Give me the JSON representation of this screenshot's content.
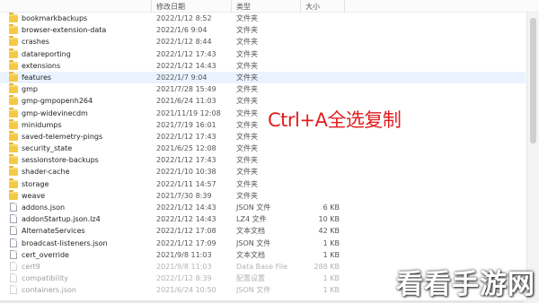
{
  "columns": {
    "name": "",
    "date": "修改日期",
    "type": "类型",
    "size": "大小"
  },
  "files": [
    {
      "name": "bookmarkbackups",
      "date": "2022/1/12 8:52",
      "type": "文件夹",
      "size": "",
      "kind": "folder"
    },
    {
      "name": "browser-extension-data",
      "date": "2022/1/6 9:04",
      "type": "文件夹",
      "size": "",
      "kind": "folder"
    },
    {
      "name": "crashes",
      "date": "2022/1/12 8:44",
      "type": "文件夹",
      "size": "",
      "kind": "folder"
    },
    {
      "name": "datareporting",
      "date": "2022/1/12 17:43",
      "type": "文件夹",
      "size": "",
      "kind": "folder"
    },
    {
      "name": "extensions",
      "date": "2022/1/12 14:43",
      "type": "文件夹",
      "size": "",
      "kind": "folder"
    },
    {
      "name": "features",
      "date": "2022/1/7 9:04",
      "type": "文件夹",
      "size": "",
      "kind": "folder",
      "selected": true
    },
    {
      "name": "gmp",
      "date": "2021/7/28 15:49",
      "type": "文件夹",
      "size": "",
      "kind": "folder"
    },
    {
      "name": "gmp-gmpopenh264",
      "date": "2021/6/24 11:03",
      "type": "文件夹",
      "size": "",
      "kind": "folder"
    },
    {
      "name": "gmp-widevinecdm",
      "date": "2021/11/19 12:08",
      "type": "文件夹",
      "size": "",
      "kind": "folder"
    },
    {
      "name": "minidumps",
      "date": "2021/7/19 16:01",
      "type": "文件夹",
      "size": "",
      "kind": "folder"
    },
    {
      "name": "saved-telemetry-pings",
      "date": "2022/1/12 17:43",
      "type": "文件夹",
      "size": "",
      "kind": "folder"
    },
    {
      "name": "security_state",
      "date": "2021/6/25 12:08",
      "type": "文件夹",
      "size": "",
      "kind": "folder"
    },
    {
      "name": "sessionstore-backups",
      "date": "2022/1/12 17:43",
      "type": "文件夹",
      "size": "",
      "kind": "folder"
    },
    {
      "name": "shader-cache",
      "date": "2022/1/10 10:38",
      "type": "文件夹",
      "size": "",
      "kind": "folder"
    },
    {
      "name": "storage",
      "date": "2022/1/11 14:57",
      "type": "文件夹",
      "size": "",
      "kind": "folder"
    },
    {
      "name": "weave",
      "date": "2021/7/30 8:39",
      "type": "文件夹",
      "size": "",
      "kind": "folder"
    },
    {
      "name": "addons.json",
      "date": "2022/1/12 14:43",
      "type": "JSON 文件",
      "size": "6 KB",
      "kind": "file"
    },
    {
      "name": "addonStartup.json.lz4",
      "date": "2022/1/12 14:43",
      "type": "LZ4 文件",
      "size": "10 KB",
      "kind": "file"
    },
    {
      "name": "AlternateServices",
      "date": "2022/1/12 17:08",
      "type": "文本文档",
      "size": "42 KB",
      "kind": "file"
    },
    {
      "name": "broadcast-listeners.json",
      "date": "2022/1/12 17:09",
      "type": "JSON 文件",
      "size": "1 KB",
      "kind": "file"
    },
    {
      "name": "cert_override",
      "date": "2021/9/8 11:03",
      "type": "文本文档",
      "size": "1 KB",
      "kind": "file"
    },
    {
      "name": "cert9",
      "date": "2021/9/8 11:03",
      "type": "Data Base File",
      "size": "288 KB",
      "kind": "file",
      "faded": true
    },
    {
      "name": "compatibility",
      "date": "2022/1/12 8:39",
      "type": "配置设置",
      "size": "1 KB",
      "kind": "file",
      "faded": true
    },
    {
      "name": "containers.json",
      "date": "2021/6/24 10:50",
      "type": "JSON 文件",
      "size": "1 KB",
      "kind": "file",
      "faded": true
    }
  ],
  "caption": "Ctrl+A全选复制",
  "watermark": "看看手游网"
}
